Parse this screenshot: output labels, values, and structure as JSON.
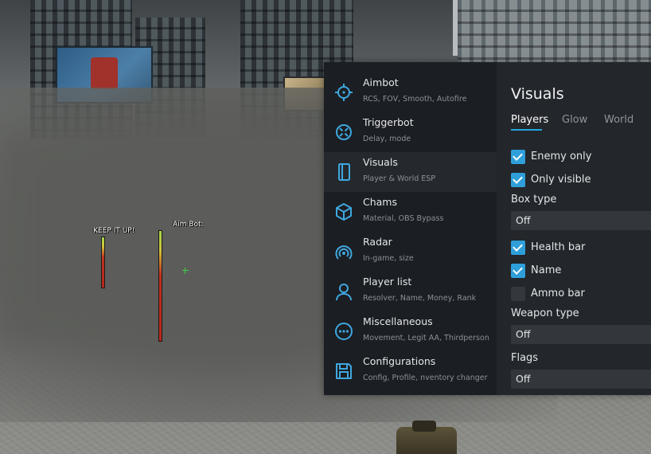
{
  "hud": {
    "label_left": "KEEP IT UP!",
    "label_right": "Aim Bot:"
  },
  "sidebar": {
    "items": [
      {
        "title": "Aimbot",
        "subtitle": "RCS, FOV, Smooth, Autofire",
        "icon": "crosshair-icon",
        "active": false
      },
      {
        "title": "Triggerbot",
        "subtitle": "Delay, mode",
        "icon": "target-icon",
        "active": false
      },
      {
        "title": "Visuals",
        "subtitle": "Player & World ESP",
        "icon": "box-outline-icon",
        "active": true
      },
      {
        "title": "Chams",
        "subtitle": "Material, OBS Bypass",
        "icon": "cube-icon",
        "active": false
      },
      {
        "title": "Radar",
        "subtitle": "In-game, size",
        "icon": "radar-icon",
        "active": false
      },
      {
        "title": "Player list",
        "subtitle": "Resolver, Name, Money, Rank",
        "icon": "person-icon",
        "active": false
      },
      {
        "title": "Miscellaneous",
        "subtitle": "Movement, Legit AA, Thirdperson",
        "icon": "more-icon",
        "active": false
      },
      {
        "title": "Configurations",
        "subtitle": "Config, Profile, nventory changer",
        "icon": "save-icon",
        "active": false
      }
    ]
  },
  "content": {
    "title": "Visuals",
    "tabs": [
      {
        "label": "Players",
        "active": true
      },
      {
        "label": "Glow",
        "active": false
      },
      {
        "label": "World",
        "active": false
      }
    ],
    "enemy_only": {
      "label": "Enemy only",
      "checked": true
    },
    "only_visible": {
      "label": "Only visible",
      "checked": true
    },
    "box_type": {
      "label": "Box type",
      "value": "Off"
    },
    "health_bar": {
      "label": "Health bar",
      "checked": true
    },
    "name": {
      "label": "Name",
      "checked": true
    },
    "ammo_bar": {
      "label": "Ammo bar",
      "checked": false
    },
    "weapon_type": {
      "label": "Weapon type",
      "value": "Off"
    },
    "flags": {
      "label": "Flags",
      "value": "Off"
    }
  },
  "colors": {
    "accent": "#2e9fd9",
    "sidebar_bg": "#1b1e22",
    "content_bg": "#23262b"
  }
}
